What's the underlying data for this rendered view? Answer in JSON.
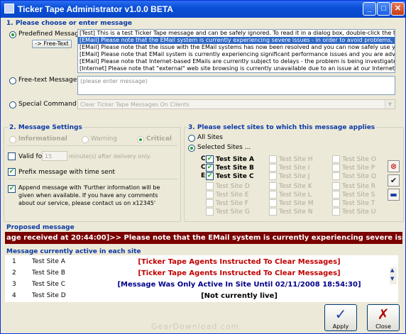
{
  "window": {
    "title": "Ticker Tape Administrator v1.0.0 BETA",
    "min_symbol": "_",
    "max_symbol": "□",
    "close_symbol": "✕"
  },
  "section1": {
    "title": "1. Please choose or enter message",
    "predefined_label": "Predefined Message",
    "free_text_link": "-> Free-Text",
    "predefined_messages": [
      "[Test] This is a test Ticker Tape message and can be safely ignored. To read it in a dialog box, double-click the tape. A",
      "[EMail] Please note that the EMail system is currently experiencing severe issues - in order to avoid problems, please cl",
      "[EMail] Please note that the issue with the EMail systems has now been resolved and you can now safely use your EMa",
      "[EMail] Please note that EMail system is currently experiencing significant performance issues and you are advised to cl",
      "[EMail] Please note that Internet-based EMails are currently subject to delays - the problem is being investigated as a ma",
      "[Internet] Please note that \"external\" web site browsing is currently unavailable due to an issue at our Internet server pro"
    ],
    "selected_index": 1,
    "free_text_label": "Free-text Message",
    "free_text_placeholder": "(please enter message)",
    "special_label": "Special Command",
    "special_value": "Clear Ticker Tape Messages On Clients"
  },
  "section2": {
    "title": "2. Message Settings",
    "levels": [
      "Informational",
      "Warning",
      "Critical"
    ],
    "valid_for_label": "Valid for",
    "valid_for_value": "15",
    "valid_for_suffix": "minute(s) after delivery only.",
    "prefix_label": "Prefix message with time sent",
    "append_label": "Append message with 'Further information will be given when available. If you have any comments about our service, please contact us on x12345'"
  },
  "section3": {
    "title": "3. Please select sites to which this message applies",
    "all_sites": "All Sites",
    "selected_sites": "Selected Sites ...",
    "row_markers": [
      "C",
      "C",
      "E"
    ],
    "sites": [
      [
        "Test Site A",
        "Test Site H",
        "Test Site O"
      ],
      [
        "Test Site B",
        "Test Site I",
        "Test Site P"
      ],
      [
        "Test Site C",
        "Test Site J",
        "Test Site Q"
      ],
      [
        "Test Site D",
        "Test Site K",
        "Test Site R"
      ],
      [
        "Test Site E",
        "Test Site L",
        "Test Site S"
      ],
      [
        "Test Site F",
        "Test Site M",
        "Test Site T"
      ],
      [
        "Test Site G",
        "Test Site N",
        "Test Site U"
      ]
    ]
  },
  "proposed": {
    "title": "Proposed message",
    "text": "age received at 20:44:00]>> Please note that the EMail system is currently experiencing severe issues - in o"
  },
  "active": {
    "title": "Message currently active in each site",
    "rows": [
      {
        "num": "1",
        "site": "Test Site A",
        "msg": "[Ticker Tape Agents Instructed To Clear Messages]",
        "color": "#c00000"
      },
      {
        "num": "2",
        "site": "Test Site B",
        "msg": "[Ticker Tape Agents Instructed To Clear Messages]",
        "color": "#c00000"
      },
      {
        "num": "3",
        "site": "Test Site C",
        "msg": "[Message Was Only Active In Site Until 02/11/2008 18:54:30]",
        "color": "#00008b"
      },
      {
        "num": "4",
        "site": "Test Site D",
        "msg": "[Not currently live]",
        "color": "#000000"
      }
    ]
  },
  "buttons": {
    "apply": "Apply",
    "close": "Close"
  },
  "icons": {
    "clear": "⊗",
    "check": "✔",
    "folder": "▬"
  },
  "watermark": "GearDownload.com"
}
